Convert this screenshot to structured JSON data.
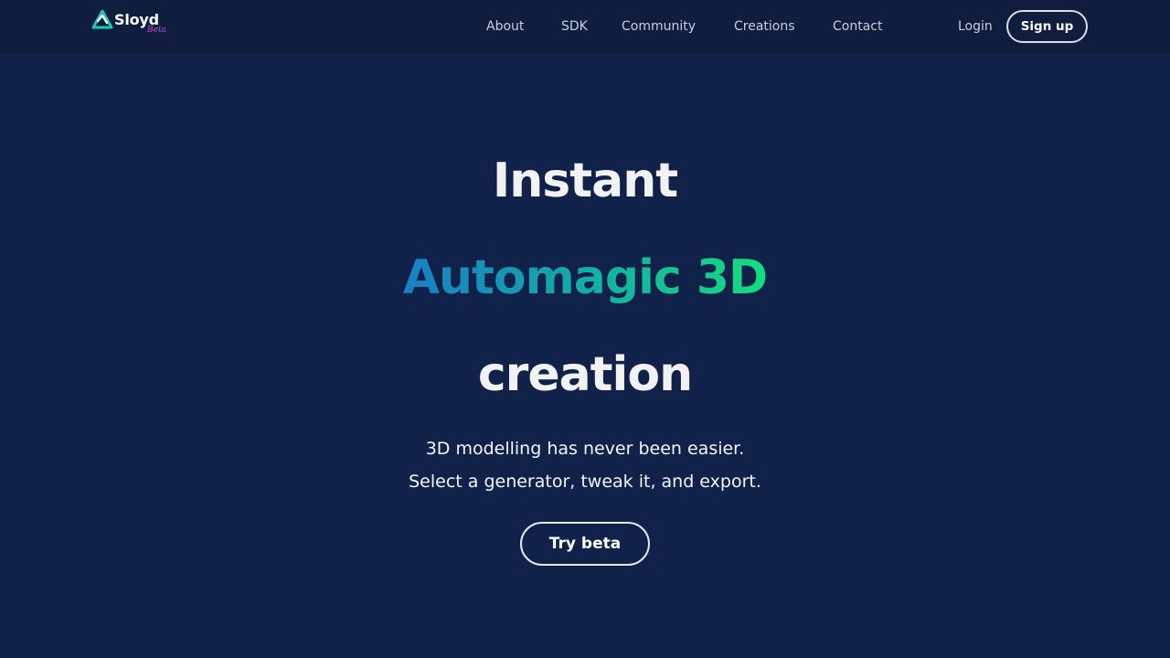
{
  "brand": {
    "name": "Sloyd",
    "tag": "Beta",
    "logo_icon": "sloyd-knot-icon",
    "colors": {
      "teal": "#1fc7b8",
      "blue": "#1a7ec4",
      "green": "#14dd7f",
      "tag": "#c04ad0"
    }
  },
  "nav": {
    "links": [
      "About",
      "SDK",
      "Community",
      "Creations",
      "Contact"
    ],
    "login": "Login",
    "signup": "Sign up"
  },
  "hero": {
    "line1": "Instant",
    "line2_word1": "Automagic",
    "line2_word2": "3D",
    "line3": "creation",
    "gradient": [
      "#1a7ec4",
      "#14a7aa",
      "#14dd7f"
    ]
  },
  "subtitle": {
    "line1": "3D modelling has never been easier.",
    "line2": "Select a generator, tweak it, and export."
  },
  "cta": {
    "label": "Try beta"
  },
  "theme": {
    "background": "#11224a",
    "navbar": "#0f1e3f"
  }
}
